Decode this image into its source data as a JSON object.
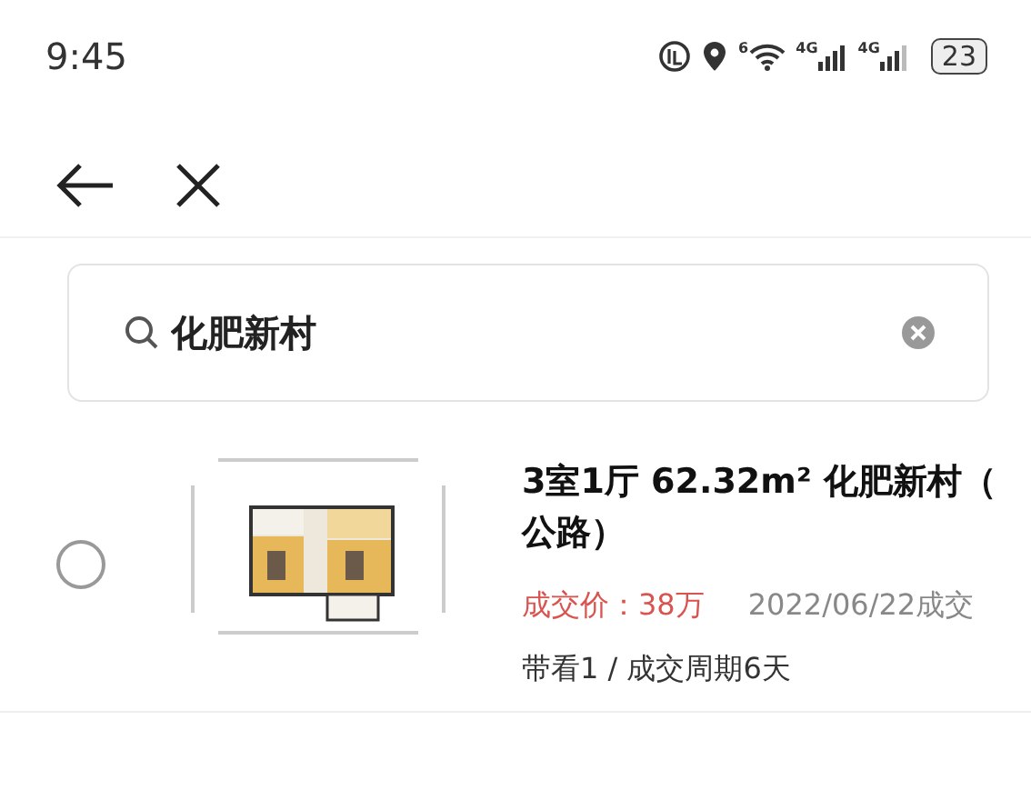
{
  "status_bar": {
    "time": "9:45",
    "wifi_badge": "6",
    "networks": [
      "4G",
      "4G"
    ],
    "battery": "23"
  },
  "search": {
    "value": "化肥新村"
  },
  "results": [
    {
      "selected": false,
      "kind": "picture",
      "title_lines": [
        "3室1厅 62.32m² 化肥新村（",
        "公路）"
      ],
      "price_label": "成交价：",
      "price": "38万",
      "date": "2022/06/22成交",
      "stats": "带看1 / 成交周期6天"
    }
  ]
}
